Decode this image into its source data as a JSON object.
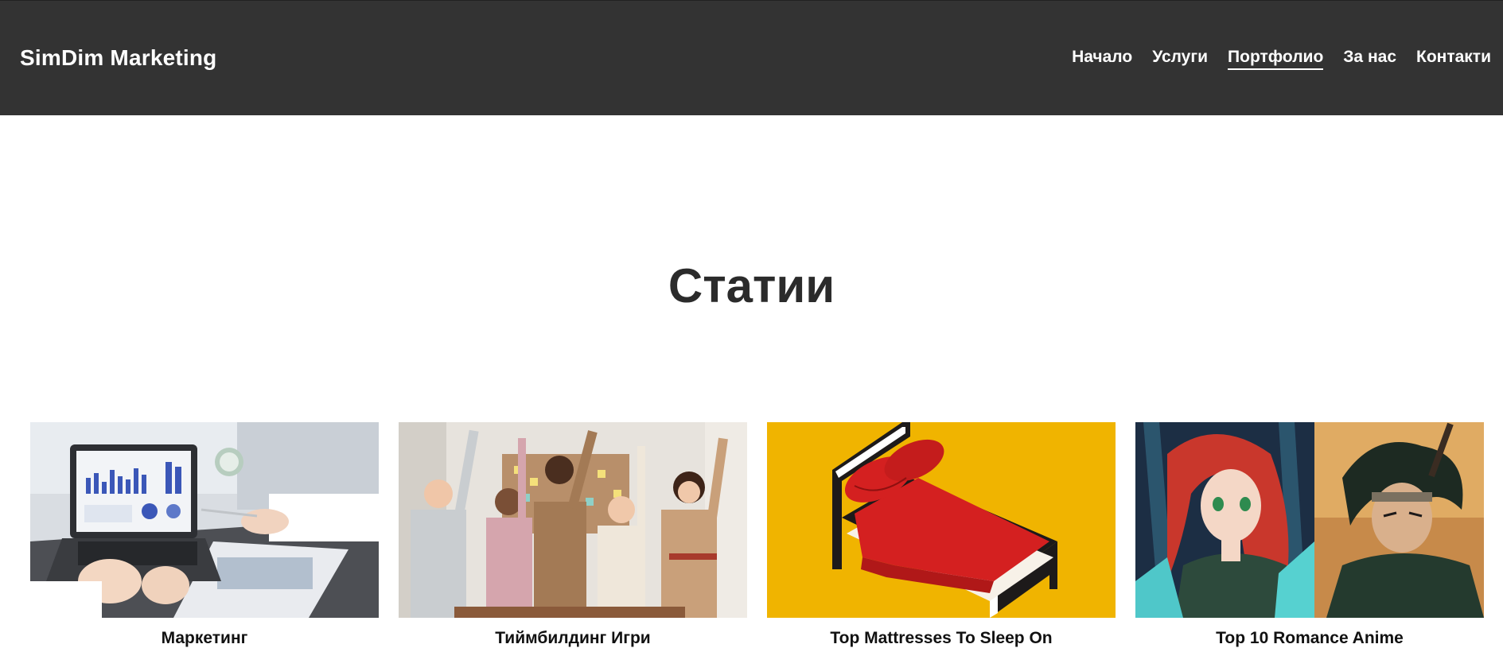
{
  "header": {
    "brand": "SimDim Marketing",
    "nav": [
      {
        "label": "Начало",
        "active": false
      },
      {
        "label": "Услуги",
        "active": false
      },
      {
        "label": "Портфолио",
        "active": true
      },
      {
        "label": "За нас",
        "active": false
      },
      {
        "label": "Контакти",
        "active": false
      }
    ]
  },
  "main": {
    "title": "Статии",
    "articles": [
      {
        "title": "Маркетинг",
        "image": "laptop-charts-photo"
      },
      {
        "title": "Тиймбилдинг Игри",
        "image": "team-celebration-photo"
      },
      {
        "title": "Top Mattresses To Sleep On",
        "image": "red-bed-illustration"
      },
      {
        "title": "Top 10 Romance Anime",
        "image": "anime-characters-illustration"
      }
    ]
  },
  "colors": {
    "header_bg": "#333333",
    "header_text": "#ffffff",
    "bed_bg": "#f0b400",
    "bed_red": "#d42020"
  }
}
